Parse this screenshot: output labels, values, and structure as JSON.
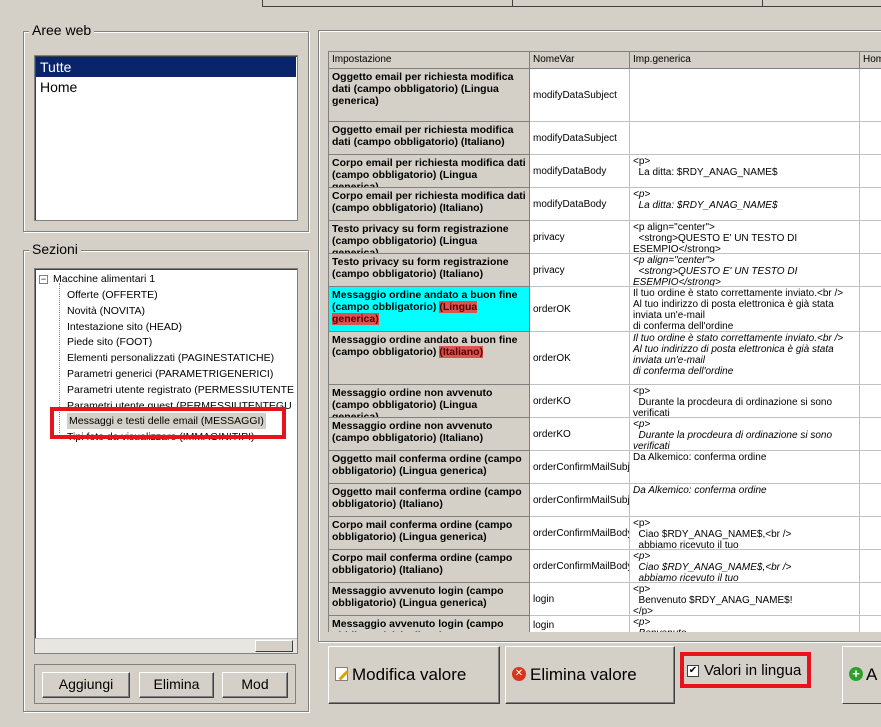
{
  "aree": {
    "label": "Aree web",
    "items": [
      "Tutte",
      "Home"
    ],
    "selected": 0
  },
  "sezioni": {
    "label": "Sezioni",
    "root": "Macchine alimentari 1",
    "expander": "−",
    "children": [
      "Offerte (OFFERTE)",
      "Novità (NOVITA)",
      "Intestazione sito (HEAD)",
      "Piede sito (FOOT)",
      "Elementi personalizzati (PAGINESTATICHE)",
      "Parametri generici (PARAMETRIGENERICI)",
      "Parametri utente registrato (PERMESSIUTENTE",
      "Parametri utente guest (PERMESSIUTENTEGU",
      "Messaggi e testi delle email (MESSAGGI)",
      "Tipi foto da visualizzare (IMMAGINITIPI)"
    ],
    "selected_index": 8,
    "buttons": [
      "Aggiungi",
      "Elimina",
      "Mod"
    ]
  },
  "grid": {
    "headers": [
      "Impostazione",
      "NomeVar",
      "Imp.generica",
      "Hom"
    ],
    "rows": [
      {
        "impostazione": "Oggetto email per richiesta modifica dati (campo obbligatorio) (Lingua generica)",
        "nomevar": "modifyDataSubject",
        "generica": "",
        "italic": false
      },
      {
        "impostazione": "Oggetto email per richiesta modifica dati (campo obbligatorio) (Italiano)",
        "nomevar": "modifyDataSubject",
        "generica": "",
        "italic": true
      },
      {
        "impostazione": "Corpo email per richiesta modifica dati (campo obbligatorio) (Lingua generica)",
        "nomevar": "modifyDataBody",
        "generica": "<p>\n  La ditta: $RDY_ANAG_NAME$",
        "italic": false
      },
      {
        "impostazione": "Corpo email per richiesta modifica dati (campo obbligatorio) (Italiano)",
        "nomevar": "modifyDataBody",
        "generica": "<p>\n  La ditta: $RDY_ANAG_NAME$",
        "italic": true
      },
      {
        "impostazione": "Testo privacy su form registrazione (campo obbligatorio) (Lingua generica)",
        "nomevar": "privacy",
        "generica": "<p align=\"center\">\n  <strong>QUESTO E' UN TESTO DI\nESEMPIO</strong>",
        "italic": false
      },
      {
        "impostazione": "Testo privacy su form registrazione (campo obbligatorio) (Italiano)",
        "nomevar": "privacy",
        "generica": "<p align=\"center\">\n  <strong>QUESTO E' UN TESTO DI\nESEMPIO</strong>",
        "italic": true
      },
      {
        "impostazione_a": "Messaggio ordine andato a buon fine (campo obbligatorio) ",
        "impostazione_b": "(Lingua generica)",
        "nomevar": "orderOK",
        "generica": "Il tuo ordine è stato correttamente inviato.<br />\nAl tuo indirizzo di posta elettronica è già stata\ninviata un'e-mail\ndi conferma dell'ordine",
        "italic": false,
        "highlight": true
      },
      {
        "impostazione_a": "Messaggio ordine andato a buon fine (campo obbligatorio) ",
        "impostazione_b": "(Italiano)",
        "nomevar": "orderOK",
        "generica": "Il tuo ordine è stato correttamente inviato.<br />\nAl tuo indirizzo di posta elettronica è già stata\ninviata un'e-mail\ndi conferma dell'ordine",
        "italic": true
      },
      {
        "impostazione": "Messaggio ordine non avvenuto (campo obbligatorio) (Lingua generica)",
        "nomevar": "orderKO",
        "generica": "<p>\n  Durante la procdeura di ordinazione si sono\nverificati",
        "italic": false
      },
      {
        "impostazione": "Messaggio ordine non avvenuto (campo obbligatorio) (Italiano)",
        "nomevar": "orderKO",
        "generica": "<p>\n  Durante la procdeura di ordinazione si sono\nverificati",
        "italic": true
      },
      {
        "impostazione": "Oggetto mail conferma ordine (campo obbligatorio) (Lingua generica)",
        "nomevar": "orderConfirmMailSubject",
        "generica": "Da Alkemico: conferma ordine",
        "italic": false
      },
      {
        "impostazione": "Oggetto mail conferma ordine (campo obbligatorio) (Italiano)",
        "nomevar": "orderConfirmMailSubject",
        "generica": "Da Alkemico: conferma ordine",
        "italic": true
      },
      {
        "impostazione": "Corpo mail conferma ordine (campo obbligatorio) (Lingua generica)",
        "nomevar": "orderConfirmMailBody",
        "generica": "<p>\n  Ciao $RDY_ANAG_NAME$,<br />\n  abbiamo ricevuto il tuo",
        "italic": false
      },
      {
        "impostazione": "Corpo mail conferma ordine (campo obbligatorio) (Italiano)",
        "nomevar": "orderConfirmMailBody",
        "generica": "<p>\n  Ciao $RDY_ANAG_NAME$,<br />\n  abbiamo ricevuto il tuo",
        "italic": true
      },
      {
        "impostazione": "Messaggio avvenuto login (campo obbligatorio) (Lingua generica)",
        "nomevar": "login",
        "generica": "<p>\n  Benvenuto $RDY_ANAG_NAME$!\n</p>",
        "italic": false
      },
      {
        "impostazione": "Messaggio avvenuto login (campo obbligatorio) (Italiano)",
        "nomevar": "login",
        "generica": "<p>\n  Benvenuto",
        "italic": true
      }
    ]
  },
  "actions": {
    "modifica": "Modifica valore",
    "elimina": "Elimina valore",
    "valori_lingua": "Valori in lingua",
    "valori_checked": "✔",
    "aggiungi": "A"
  },
  "icons": {
    "modifica": "edit-icon",
    "elimina": "delete-icon",
    "aggiungi": "add-icon"
  },
  "colors": {
    "highlight": "#00ffff",
    "selection": "#0a246a",
    "annotation": "#e8121c"
  }
}
